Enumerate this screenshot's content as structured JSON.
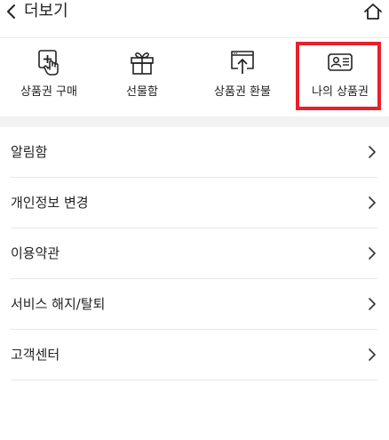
{
  "header": {
    "title": "더보기",
    "back_icon": "chevron-left-icon",
    "home_icon": "home-icon"
  },
  "quick_menu": {
    "items": [
      {
        "label": "상품권 구매",
        "icon": "gift-card-purchase-icon"
      },
      {
        "label": "선물함",
        "icon": "gift-box-icon"
      },
      {
        "label": "상품권 환불",
        "icon": "refund-icon"
      },
      {
        "label": "나의 상품권",
        "icon": "id-card-icon"
      }
    ],
    "highlight_color": "#e8202a"
  },
  "menu": {
    "items": [
      {
        "label": "알림함"
      },
      {
        "label": "개인정보 변경"
      },
      {
        "label": "이용약관"
      },
      {
        "label": "서비스 해지/탈퇴"
      },
      {
        "label": "고객센터"
      }
    ]
  }
}
